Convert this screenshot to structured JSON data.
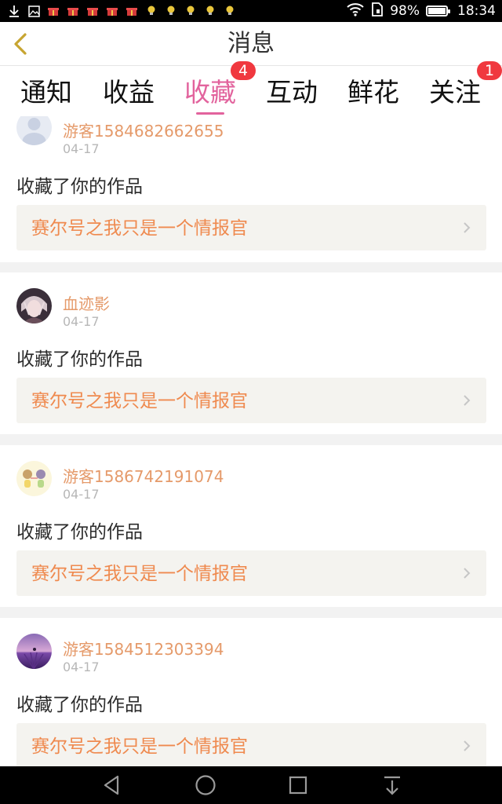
{
  "status_bar": {
    "battery_percent": "98%",
    "time": "18:34",
    "battery_level": 0.98,
    "left_icons": [
      "download-icon",
      "image-icon",
      "gift-icon",
      "gift-icon",
      "gift-icon",
      "gift-icon",
      "gift-icon",
      "bulb-icon",
      "bulb-icon",
      "bulb-icon",
      "bulb-icon",
      "bulb-icon"
    ],
    "right_icons": [
      "wifi-icon",
      "sim-icon",
      "battery-icon"
    ]
  },
  "header": {
    "title": "消息",
    "back_icon": "chevron-left-icon"
  },
  "tabs": [
    {
      "label": "通知",
      "badge": ""
    },
    {
      "label": "收益",
      "badge": ""
    },
    {
      "label": "收藏",
      "badge": "4",
      "active": true
    },
    {
      "label": "互动",
      "badge": ""
    },
    {
      "label": "鲜花",
      "badge": ""
    },
    {
      "label": "关注",
      "badge": "1"
    }
  ],
  "messages": [
    {
      "username": "游客1584682662655",
      "date": "04-17",
      "action": "收藏了你的作品",
      "work_title": "赛尔号之我只是一个情报官",
      "avatar": "default-avatar"
    },
    {
      "username": "血迹影",
      "date": "04-17",
      "action": "收藏了你的作品",
      "work_title": "赛尔号之我只是一个情报官",
      "avatar": "anime-portrait-avatar"
    },
    {
      "username": "游客1586742191074",
      "date": "04-17",
      "action": "收藏了你的作品",
      "work_title": "赛尔号之我只是一个情报官",
      "avatar": "cartoon-couple-avatar"
    },
    {
      "username": "游客1584512303394",
      "date": "04-17",
      "action": "收藏了你的作品",
      "work_title": "赛尔号之我只是一个情报官",
      "avatar": "lavender-field-avatar"
    }
  ],
  "nav_bar": {
    "icons": [
      "back-triangle-icon",
      "home-circle-icon",
      "recents-square-icon",
      "notification-pull-icon"
    ]
  },
  "colors": {
    "accent": "#e2639d",
    "username": "#e59a6a",
    "work_title": "#ef8a4f",
    "badge": "#f0383f"
  }
}
